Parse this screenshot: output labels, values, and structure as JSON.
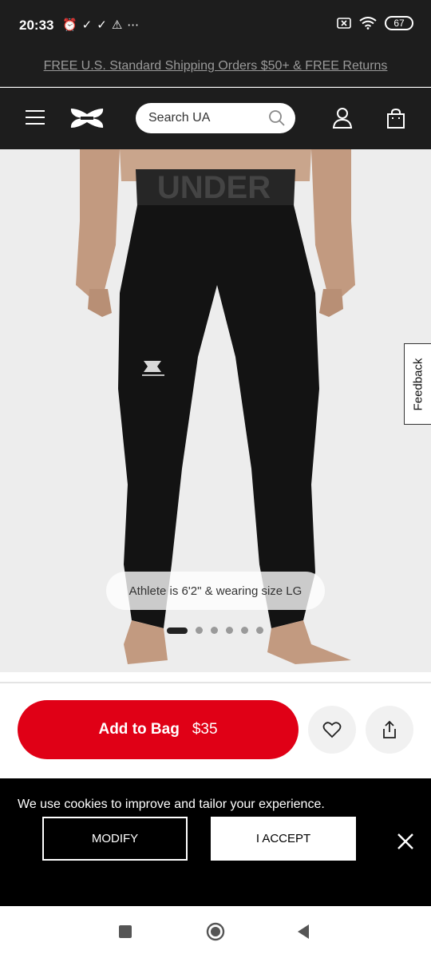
{
  "status_bar": {
    "time": "20:33",
    "battery": "67"
  },
  "promo": {
    "text": "FREE U.S. Standard Shipping Orders $50+ & FREE Returns"
  },
  "header": {
    "search_placeholder": "Search UA"
  },
  "product": {
    "caption": "Athlete is 6'2\" & wearing size LG",
    "waistband_text": "UNDER",
    "carousel": {
      "count": 6,
      "active": 1
    }
  },
  "feedback": {
    "label": "Feedback"
  },
  "actions": {
    "add_to_bag": "Add to Bag",
    "price": "$35"
  },
  "cookie": {
    "message": "We use cookies to improve and tailor your experience.",
    "modify": "MODIFY",
    "accept": "I ACCEPT"
  },
  "colors": {
    "accent_red": "#e00016",
    "header_bg": "#1d1d1d"
  },
  "icons": [
    "alarm-icon",
    "check-icon",
    "warning-icon",
    "wifi-icon",
    "menu-icon",
    "search-icon",
    "account-icon",
    "bag-icon",
    "heart-icon",
    "share-icon",
    "close-icon"
  ]
}
